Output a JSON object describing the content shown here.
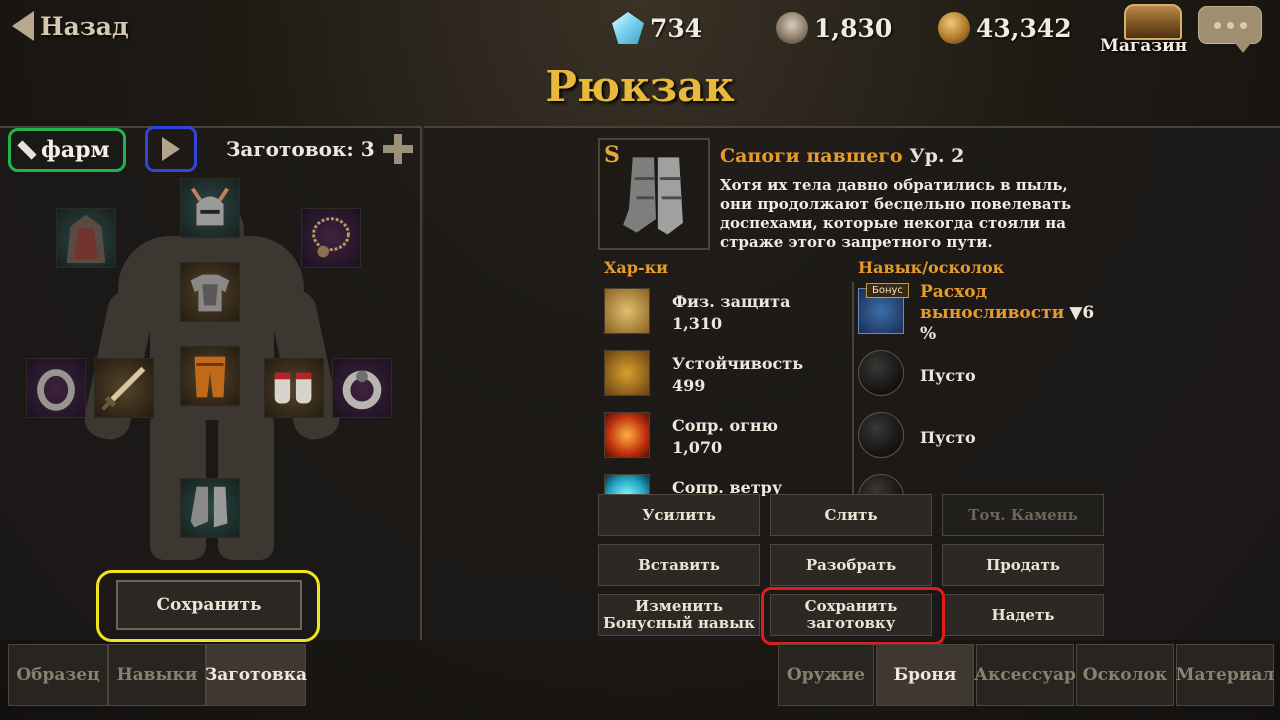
{
  "header": {
    "back_label": "Назад",
    "gems": "734",
    "skulls": "1,830",
    "gold": "43,342",
    "shop_label": "Магазин",
    "title": "Рюкзак"
  },
  "preset": {
    "name": "фарм",
    "count_label": "Заготовок: 3"
  },
  "equipment_slots": [
    {
      "name": "cloak",
      "icon": "cloak-icon"
    },
    {
      "name": "helmet",
      "icon": "helmet-icon"
    },
    {
      "name": "necklace",
      "icon": "necklace-icon"
    },
    {
      "name": "chest",
      "icon": "chest-armor-icon"
    },
    {
      "name": "pants",
      "icon": "pants-icon"
    },
    {
      "name": "ring-left",
      "icon": "ring-icon"
    },
    {
      "name": "weapon",
      "icon": "sword-icon"
    },
    {
      "name": "gloves",
      "icon": "gloves-icon"
    },
    {
      "name": "ring-right",
      "icon": "ring-icon"
    },
    {
      "name": "boots",
      "icon": "boots-icon"
    }
  ],
  "save_button": "Сохранить",
  "left_tabs": [
    "Образец",
    "Навыки",
    "Заготовка"
  ],
  "left_tab_active": "Заготовка",
  "item": {
    "rank": "S",
    "name": "Сапоги павшего",
    "level": "Ур. 2",
    "description": "Хотя их тела давно обратились в пыль, они продолжают бесцельно повелевать доспехами, которые некогда стояли на страже этого запретного пути."
  },
  "stats_header": "Хар-ки",
  "stats": [
    {
      "name": "Физ. защита",
      "value": "1,310",
      "icon": "shield-icon"
    },
    {
      "name": "Устойчивость",
      "value": "499",
      "icon": "gear-shield-icon"
    },
    {
      "name": "Сопр. огню",
      "value": "1,070",
      "icon": "fire-icon"
    },
    {
      "name": "Сопр. ветру",
      "value": "",
      "icon": "wind-icon"
    }
  ],
  "skills_header": "Навык/осколок",
  "skills": {
    "bonus_badge": "Бонус",
    "bonus_line1": "Расход",
    "bonus_line2": "выносливости",
    "bonus_value": "▼6",
    "bonus_unit": "%",
    "empty1": "Пусто",
    "empty2": "Пусто"
  },
  "actions": {
    "enhance": "Усилить",
    "merge": "Слить",
    "whetstone": "Точ. Камень",
    "insert": "Вставить",
    "disassemble": "Разобрать",
    "sell": "Продать",
    "change_bonus_1": "Изменить",
    "change_bonus_2": "Бонусный навык",
    "save_preset_1": "Сохранить",
    "save_preset_2": "заготовку",
    "equip": "Надеть"
  },
  "right_tabs": [
    "Оружие",
    "Броня",
    "Аксессуар",
    "Осколок",
    "Материал"
  ],
  "right_tab_active": "Броня"
}
